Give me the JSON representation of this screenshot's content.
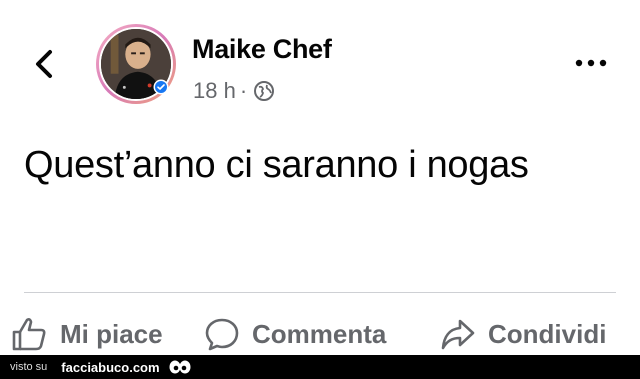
{
  "post": {
    "author_name": "Maike Chef",
    "time": "18 h",
    "separator": "·",
    "text": "Quest’anno ci saranno i nogas"
  },
  "icons": {
    "back": "chevron-left-icon",
    "more": "ellipsis-icon",
    "audience": "globe-icon",
    "verified": "verified-badge-icon",
    "like": "thumbs-up-icon",
    "comment": "comment-bubble-icon",
    "share": "share-arrow-icon"
  },
  "actions": {
    "like_label": "Mi piace",
    "comment_label": "Commenta",
    "share_label": "Condividi"
  },
  "footer": {
    "prefix": "visto su",
    "site": "facciabuco.com"
  },
  "colors": {
    "text_primary": "#050505",
    "text_secondary": "#65676b",
    "divider": "#ced0d4",
    "verified_blue": "#1877f2",
    "footer_bg": "#000000"
  }
}
